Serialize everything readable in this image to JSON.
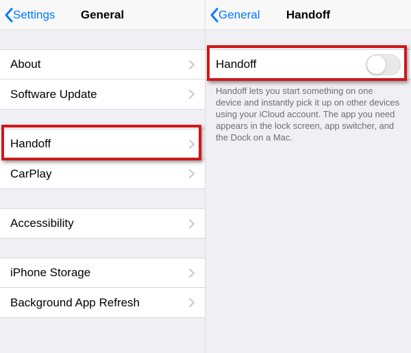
{
  "left": {
    "back_label": "Settings",
    "title": "General",
    "groups": [
      [
        {
          "label": "About"
        },
        {
          "label": "Software Update"
        }
      ],
      [
        {
          "label": "Handoff",
          "highlight": true
        },
        {
          "label": "CarPlay"
        }
      ],
      [
        {
          "label": "Accessibility"
        }
      ],
      [
        {
          "label": "iPhone Storage"
        },
        {
          "label": "Background App Refresh"
        }
      ]
    ]
  },
  "right": {
    "back_label": "General",
    "title": "Handoff",
    "toggle_label": "Handoff",
    "toggle_on": false,
    "description": "Handoff lets you start something on one device and instantly pick it up on other devices using your iCloud account. The app you need appears in the lock screen, app switcher, and the Dock on a Mac."
  }
}
